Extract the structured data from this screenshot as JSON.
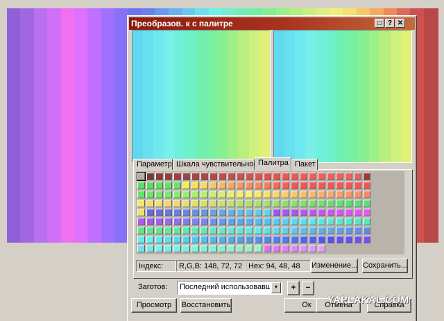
{
  "window": {
    "title": "Преобразов. к с палитре",
    "controls": {
      "restore": "□",
      "help": "?",
      "close": "✕"
    }
  },
  "background_stripes": [
    "#9060d8",
    "#a068e0",
    "#b870f0",
    "#d070f8",
    "#f070f0",
    "#e070ff",
    "#c070ff",
    "#a070ff",
    "#8870f8",
    "#7070f0",
    "#6880f0",
    "#6898f0",
    "#68b0f0",
    "#68c8f0",
    "#68e0f0",
    "#70f0e8",
    "#70f0d0",
    "#70f0b8",
    "#70f0a0",
    "#80f090",
    "#98f088",
    "#b0f080",
    "#c8f080",
    "#e0f080",
    "#f0f078",
    "#f8e070",
    "#f8c868",
    "#f8a860",
    "#f08858",
    "#e06858",
    "#d05050",
    "#b84848"
  ],
  "preview_stripes": [
    "#60d8f0",
    "#68e0f0",
    "#70e8f0",
    "#78f0e8",
    "#70f0d8",
    "#70f0c8",
    "#70f0b0",
    "#78f0a0",
    "#88f090",
    "#a0f088",
    "#b8f080",
    "#d0f080",
    "#e0f078"
  ],
  "tabs": [
    {
      "label": "Параметр",
      "active": false
    },
    {
      "label": "Шкала чувствительности",
      "active": false
    },
    {
      "label": "Палитра",
      "active": true
    },
    {
      "label": "Пакет",
      "active": false
    }
  ],
  "palette": {
    "rows": [
      [
        "#b4b0a8",
        "#7c3a3a",
        "#8a3c3c",
        "#943e3e",
        "#9c4040",
        "#a04242",
        "#a84444",
        "#b04646",
        "#b84848",
        "#c04a4a",
        "#c84c4c",
        "#d04e4e",
        "#d85050",
        "#e05252",
        "#e05050",
        "#e85454",
        "#f05656",
        "#f05858",
        "#f05a5a",
        "#f05c5c",
        "#f05e5e",
        "#f06060",
        "#e86262",
        "#e86464",
        "#e06666",
        "#9c3838"
      ],
      [
        "#58e060",
        "#58e058",
        "#60e060",
        "#60e468",
        "#68e468",
        "#f0f048",
        "#f8e058",
        "#f8d860",
        "#f8c860",
        "#f8b860",
        "#f8a860",
        "#f89860",
        "#f89060",
        "#f88860",
        "#f87858",
        "#f86858",
        "#f06058",
        "#f05858",
        "#f05858",
        "#f05858",
        "#f05858",
        "#f05858",
        "#f05858",
        "#f05858",
        "#f05858",
        "#f05858"
      ],
      [
        "#60e860",
        "#68e868",
        "#70e870",
        "#78e870",
        "#88ec70",
        "#98f070",
        "#a8f070",
        "#b8f070",
        "#c8f070",
        "#d8f070",
        "#e8f070",
        "#f0f070",
        "#f8f070",
        "#f8e868",
        "#f8e068",
        "#f8d868",
        "#f8d068",
        "#f8c868",
        "#f8c068",
        "#f8b868",
        "#f8b068",
        "#f8a868",
        "#f8a068",
        "#f89868",
        "#f89068",
        "#f88868"
      ],
      [
        "#f0e868",
        "#f0e068",
        "#f0e070",
        "#f0d870",
        "#f0d870",
        "#e8e070",
        "#e0e070",
        "#d8e070",
        "#d0e070",
        "#c8e070",
        "#c0e070",
        "#b8e070",
        "#b0e070",
        "#a8e070",
        "#a0e070",
        "#98e070",
        "#90e070",
        "#88e070",
        "#80e070",
        "#78e070",
        "#70e070",
        "#68e070",
        "#60e070",
        "#58e070",
        "#58e078",
        "#58e080"
      ],
      [
        "#f0e070",
        "#6868e0",
        "#6870e0",
        "#6878e0",
        "#6880e0",
        "#6888e0",
        "#6890e0",
        "#6898e0",
        "#68a0e0",
        "#68a8e0",
        "#68b0e0",
        "#68b8e0",
        "#68c0e0",
        "#68c8e0",
        "#68d0e0",
        "#9858f0",
        "#a058f0",
        "#a858f0",
        "#b058f0",
        "#b858f0",
        "#c058f0",
        "#c858f0",
        "#d058f0",
        "#d858f0",
        "#e058f0",
        "#e858f0"
      ],
      [
        "#b058f0",
        "#a858f0",
        "#a060f0",
        "#9868f0",
        "#9070f0",
        "#8878f0",
        "#8080f0",
        "#7888f0",
        "#7090f0",
        "#6898f0",
        "#60a0f0",
        "#58a8f0",
        "#58b0f0",
        "#58b8f0",
        "#58c0f0",
        "#58c8f0",
        "#58d0f0",
        "#58d8f0",
        "#58e0f0",
        "#58e8e8",
        "#58e8e0",
        "#58e8d8",
        "#58e8d0",
        "#58e8c8",
        "#58e8c0",
        "#58e8b8"
      ],
      [
        "#60e880",
        "#60e888",
        "#60e890",
        "#60e898",
        "#60e8a0",
        "#60e8a8",
        "#60e8b0",
        "#60e8b8",
        "#60e8c0",
        "#60e8c8",
        "#60e8d0",
        "#60e8d8",
        "#60e8e0",
        "#60e8e8",
        "#60e0e8",
        "#60d8e8",
        "#60d0e8",
        "#60c8e8",
        "#60c0e8",
        "#60b8e8",
        "#60b0e8",
        "#60a8e8",
        "#60a0e8",
        "#6098e8",
        "#6090e8",
        "#6088e8"
      ],
      [
        "#60f0f0",
        "#68f0f0",
        "#60e8f0",
        "#58e0f0",
        "#58d8f0",
        "#50d0f0",
        "#50c8f0",
        "#50c0f0",
        "#50b8f0",
        "#50b0f0",
        "#50a8f0",
        "#50a0f0",
        "#5098f0",
        "#5090f0",
        "#5088f0",
        "#5080f0",
        "#5078f0",
        "#5070f0",
        "#5068f0",
        "#5060f0",
        "#5058f0",
        "#5850f0",
        "#6050f0",
        "#6850f0",
        "#7050f0",
        "#7850f0"
      ],
      [
        "#70e0f0",
        "#70e8f0",
        "#70f0f0",
        "#70f0e8",
        "#78f0e8",
        "#78f0e0",
        "#80f0e0",
        "#80f0d8",
        "#88f0d8",
        "#88f0d0",
        "#90f0d0",
        "#90f0c8",
        "#98f0c8",
        "#a0f0c8",
        "#e070f0",
        "#e078f0",
        "#e080f0",
        "#e088f0",
        "#e090f0",
        "#e098f0",
        "#e0a0f0",
        "",
        "",
        "",
        "",
        ""
      ]
    ],
    "selected": [
      0,
      0
    ]
  },
  "info": {
    "index_label": "Індекс:",
    "rgb_label": "R,G,B: 148,  72,  72",
    "hex_label": "Hex: 94, 48, 48"
  },
  "buttons": {
    "edit": "Изменение...",
    "save": "Сохранить...",
    "preview": "Просмотр",
    "restore": "Восстановить",
    "ok": "Ок",
    "cancel": "Отмена",
    "help": "Справка",
    "add": "+",
    "remove": "−"
  },
  "preset": {
    "label": "Заготов:",
    "value": "Последний использовавшийся"
  },
  "watermark": "YAPLAKAL.COM"
}
